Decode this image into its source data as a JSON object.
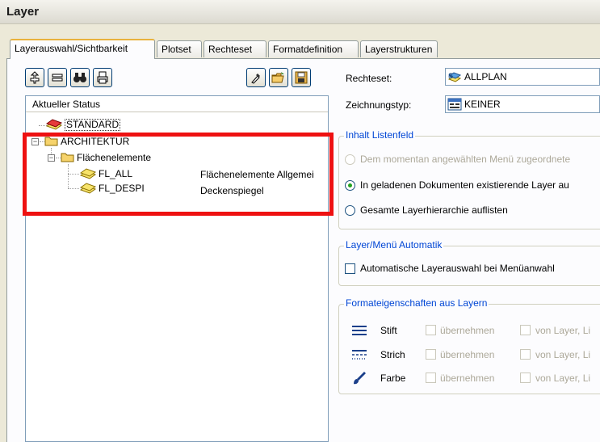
{
  "window": {
    "title": "Layer"
  },
  "tabs": [
    {
      "label": "Layerauswahl/Sichtbarkeit",
      "active": true
    },
    {
      "label": "Plotset",
      "active": false
    },
    {
      "label": "Rechteset",
      "active": false
    },
    {
      "label": "Formatdefinition",
      "active": false
    },
    {
      "label": "Layerstrukturen",
      "active": false
    }
  ],
  "toolbar": {
    "left": [
      "layer-new-icon",
      "layer-list-icon",
      "find-binoculars-icon",
      "print-icon"
    ],
    "right": [
      "eyedropper-icon",
      "open-folder-icon",
      "save-disk-icon"
    ]
  },
  "tree": {
    "header": "Aktueller Status",
    "standard_label": "STANDARD",
    "architektur_label": "ARCHITEKTUR",
    "flaechen_label": "Flächenelemente",
    "items": [
      {
        "name": "FL_ALL",
        "description": "Flächenelemente Allgemei"
      },
      {
        "name": "FL_DESPI",
        "description": "Deckenspiegel"
      }
    ]
  },
  "right": {
    "rechteset_label": "Rechteset:",
    "rechteset_value": "ALLPLAN",
    "zeichnungstyp_label": "Zeichnungstyp:",
    "zeichnungstyp_value": "KEINER"
  },
  "inhalt": {
    "title": "Inhalt Listenfeld",
    "option1": "Dem momentan angewählten Menü zugeordnete",
    "option2": "In geladenen Dokumenten existierende Layer au",
    "option3": "Gesamte Layerhierarchie auflisten"
  },
  "automatik": {
    "title": "Layer/Menü Automatik",
    "checkbox": "Automatische Layerauswahl bei Menüanwahl"
  },
  "format": {
    "title": "Formateigenschaften aus Layern",
    "rows": [
      {
        "icon": "pen-lines-icon",
        "label": "Stift",
        "take": "übernehmen",
        "from": "von Layer, Li"
      },
      {
        "icon": "dashed-lines-icon",
        "label": "Strich",
        "take": "übernehmen",
        "from": "von Layer, Li"
      },
      {
        "icon": "color-brush-icon",
        "label": "Farbe",
        "take": "übernehmen",
        "from": "von Layer, Li"
      }
    ]
  },
  "colors": {
    "highlight": "#ee1111",
    "group_title": "#0046d5",
    "tab_accent": "#e9b23c"
  }
}
